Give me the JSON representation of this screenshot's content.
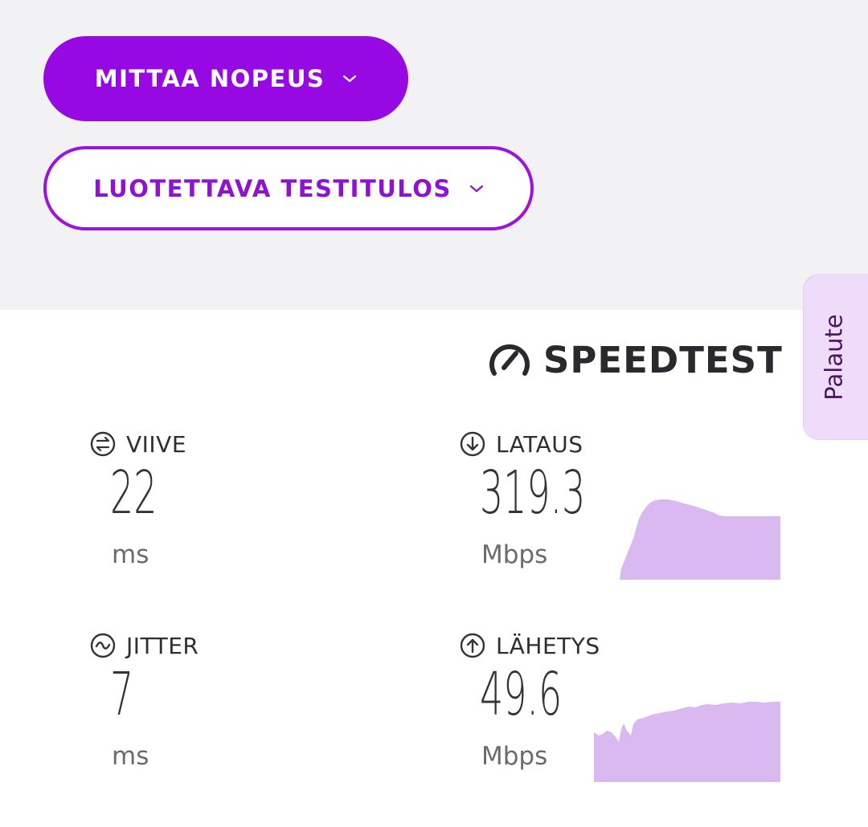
{
  "buttons": {
    "measure_speed": "MITTAA NOPEUS",
    "reliable_result": "LUOTETTAVA TESTITULOS"
  },
  "feedback_tab": "Palaute",
  "speedtest_logo": "SPEEDTEST",
  "metrics": {
    "latency": {
      "label": "VIIVE",
      "value": "22",
      "unit": "ms",
      "icon": "latency-icon"
    },
    "download": {
      "label": "LATAUS",
      "value": "319.3",
      "unit": "Mbps",
      "icon": "download-arrow-icon"
    },
    "jitter": {
      "label": "JITTER",
      "value": "7",
      "unit": "ms",
      "icon": "jitter-wave-icon"
    },
    "upload": {
      "label": "LÄHETYS",
      "value": "49.6",
      "unit": "Mbps",
      "icon": "upload-arrow-icon"
    }
  },
  "colors": {
    "primary": "#9609e3",
    "outline": "#9c14dc",
    "graph_fill": "#dab9f1",
    "feedback_bg": "#efdcfb"
  }
}
